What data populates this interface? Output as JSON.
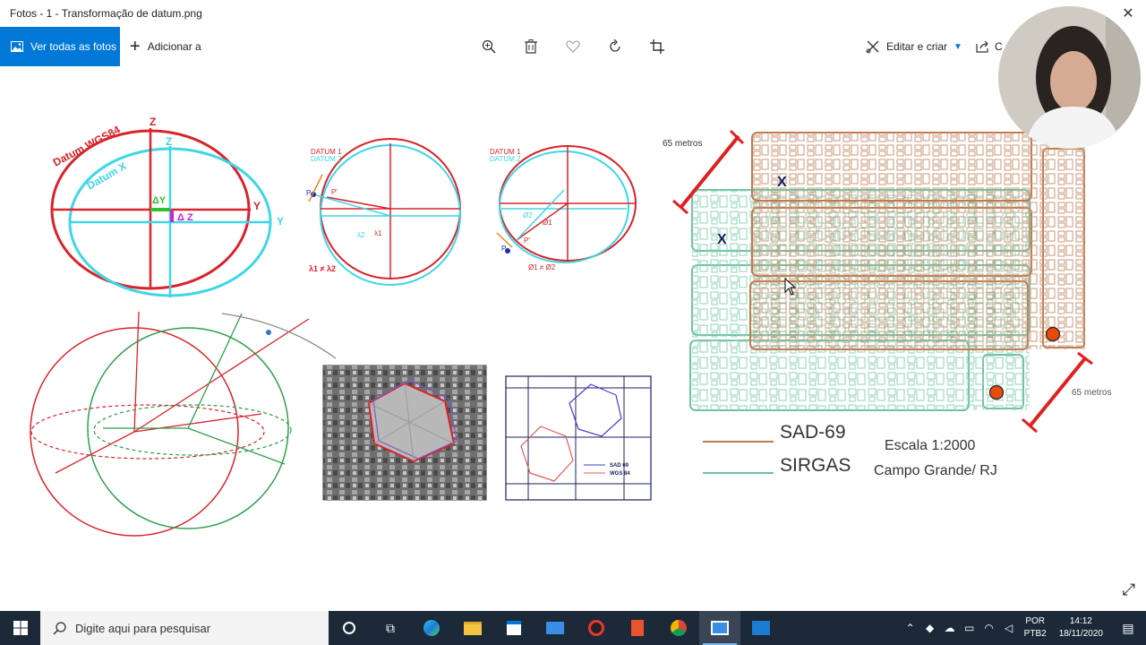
{
  "window": {
    "title": "Fotos - 1 - Transformação de datum.png"
  },
  "toolbar": {
    "view_all": "Ver todas as fotos",
    "add_to": "Adicionar a",
    "edit_create": "Editar e criar",
    "share_partial": "C"
  },
  "figure": {
    "top_left": {
      "datum_wgs84": "Datum WGS84",
      "datum_x": "Datum X",
      "z1": "Z",
      "z2": "Z",
      "y1": "Y",
      "y2": "Y",
      "dy": "ΔY",
      "dz": "Δ Z"
    },
    "top_mid": {
      "datum1": "DATUM 1",
      "datum2": "DATUM 2",
      "p": "P",
      "pp": "P'",
      "l2": "λ2",
      "l1": "λ1",
      "ineq": "λ1 ≠ λ2"
    },
    "top_mid2": {
      "datum1": "DATUM 1",
      "datum2": "DATUM 2",
      "phi2": "Ø2",
      "phi1": "Ø1",
      "p": "P",
      "pp": "P'",
      "ineq": "Ø1 ≠ Ø2"
    },
    "legend_small": {
      "sad69": "SAD 69",
      "wgs84": "WGS 84"
    },
    "map": {
      "dist_top": "65 metros",
      "dist_bottom": "65 metros",
      "x_mark": "X",
      "sad69": "SAD-69",
      "sirgas": "SIRGAS",
      "scale": "Escala 1:2000",
      "place": "Campo Grande/ RJ"
    },
    "colors": {
      "sad69": "#c07a4e",
      "sirgas": "#6fc1a0"
    }
  },
  "taskbar": {
    "search_placeholder": "Digite aqui para pesquisar",
    "lang_top": "POR",
    "lang_bottom": "PTB2",
    "time": "14:12",
    "date": "18/11/2020"
  }
}
